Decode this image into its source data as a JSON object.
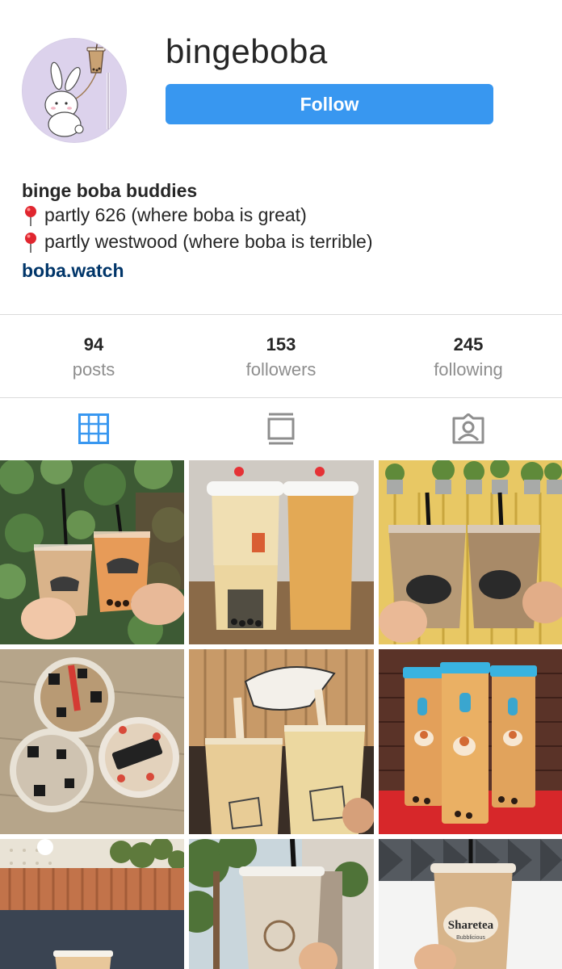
{
  "profile": {
    "username": "bingeboba",
    "follow_label": "Follow",
    "bio_name": "binge boba buddies",
    "bio_lines": [
      "partly 626 (where boba is great)",
      "partly westwood (where boba is terrible)"
    ],
    "bio_icon": "round-pushpin-icon",
    "link": "boba.watch"
  },
  "stats": [
    {
      "count": "94",
      "label": "posts"
    },
    {
      "count": "153",
      "label": "followers"
    },
    {
      "count": "245",
      "label": "following"
    }
  ],
  "tabs": [
    {
      "name": "grid-view",
      "icon": "grid-icon",
      "active": true
    },
    {
      "name": "feed-view",
      "icon": "feed-icon",
      "active": false
    },
    {
      "name": "tagged",
      "icon": "tagged-person-icon",
      "active": false
    }
  ],
  "colors": {
    "follow_button": "#3897f0",
    "link": "#003569",
    "active_tab": "#3897f0",
    "inactive_tab": "#8e8e8e",
    "divider": "#dbdbdb",
    "pin": "#e0262f"
  },
  "posts": [
    {
      "subject": "two boba drinks against ivy wall"
    },
    {
      "subject": "two boba cups with red heart lids"
    },
    {
      "subject": "two boba cups under potted plants"
    },
    {
      "subject": "four boba cups with black and white decorations"
    },
    {
      "subject": "two milk tea cups with boba illustration"
    },
    {
      "subject": "three corgi printed tall cups"
    },
    {
      "subject": "milk tea in cafe"
    },
    {
      "subject": "milk tea on street"
    },
    {
      "subject": "Sharetea milk tea"
    }
  ],
  "post_texts": {
    "sharetea_label": "Sharetea",
    "sharetea_sub": "Bubblicious"
  }
}
